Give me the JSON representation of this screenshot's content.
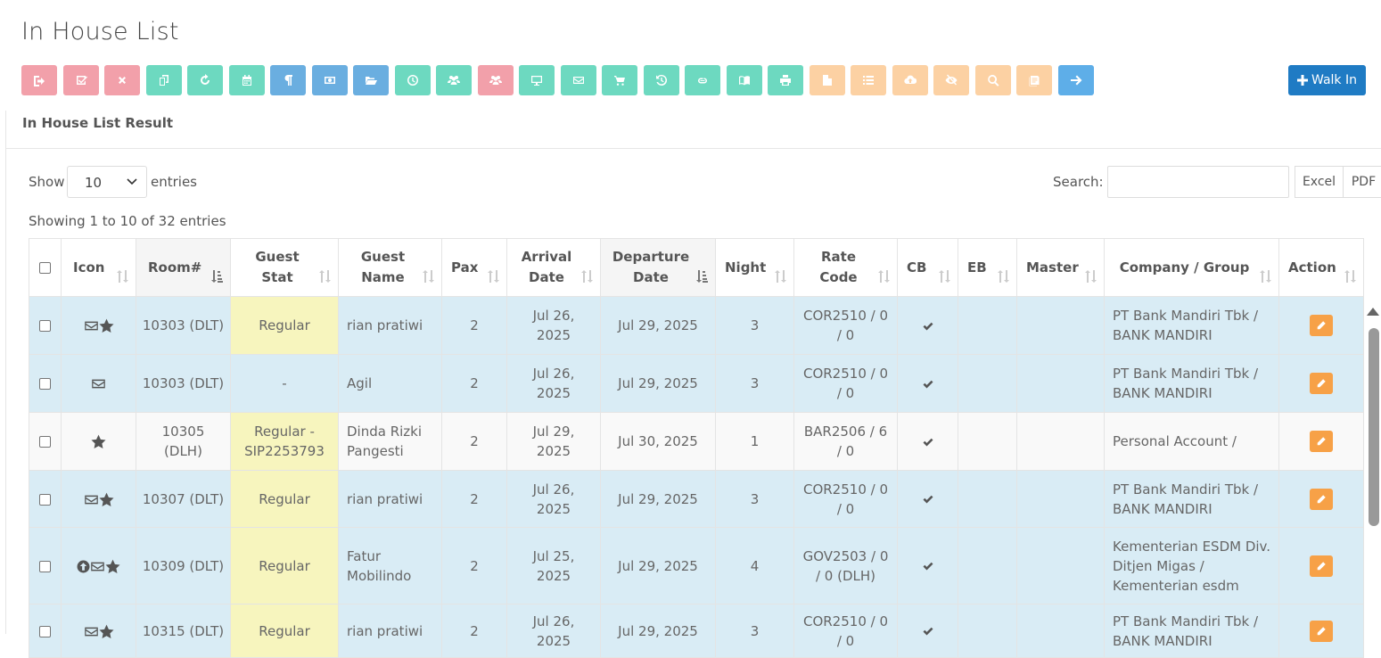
{
  "page": {
    "title": "In House List"
  },
  "toolbar": {
    "buttons": [
      {
        "icon": "sign-out-icon",
        "color": "#f2a0aa"
      },
      {
        "icon": "check-square-icon",
        "color": "#f2a0aa"
      },
      {
        "icon": "times-icon",
        "color": "#f2a0aa"
      },
      {
        "icon": "copy-icon",
        "color": "#6dd9c0"
      },
      {
        "icon": "refresh-icon",
        "color": "#6dd9c0"
      },
      {
        "icon": "calendar-icon",
        "color": "#6dd9c0"
      },
      {
        "icon": "paragraph-icon",
        "color": "#6aaee0"
      },
      {
        "icon": "money-icon",
        "color": "#6aaee0"
      },
      {
        "icon": "folder-open-icon",
        "color": "#6aaee0"
      },
      {
        "icon": "clock-icon",
        "color": "#6dd9c0"
      },
      {
        "icon": "users-icon",
        "color": "#6dd9c0"
      },
      {
        "icon": "users-icon",
        "color": "#f2a0aa"
      },
      {
        "icon": "desktop-icon",
        "color": "#6dd9c0"
      },
      {
        "icon": "envelope-icon",
        "color": "#6dd9c0"
      },
      {
        "icon": "cart-icon",
        "color": "#6dd9c0"
      },
      {
        "icon": "history-icon",
        "color": "#6dd9c0"
      },
      {
        "icon": "link-icon",
        "color": "#6dd9c0"
      },
      {
        "icon": "book-icon",
        "color": "#6dd9c0"
      },
      {
        "icon": "print-icon",
        "color": "#6dd9c0"
      },
      {
        "icon": "file-icon",
        "color": "#fcd1a3"
      },
      {
        "icon": "list-icon",
        "color": "#fcd1a3"
      },
      {
        "icon": "cloud-upload-icon",
        "color": "#fcd1a3"
      },
      {
        "icon": "eye-slash-icon",
        "color": "#fcd1a3"
      },
      {
        "icon": "search-icon",
        "color": "#fcd1a3"
      },
      {
        "icon": "notes-icon",
        "color": "#fcd1a3"
      },
      {
        "icon": "arrow-right-icon",
        "color": "#5eaee8"
      }
    ],
    "walk_in_label": "Walk In"
  },
  "panel": {
    "title": "In House List Result"
  },
  "controls": {
    "show_label": "Show",
    "entries_value": "10",
    "entries_label": "entries",
    "search_label": "Search:",
    "search_value": "",
    "excel_label": "Excel",
    "pdf_label": "PDF",
    "info": "Showing 1 to 10 of 32 entries"
  },
  "table": {
    "headers": {
      "icon": "Icon",
      "room": "Room#",
      "guest_stat": [
        "Guest",
        "Stat"
      ],
      "guest_name": [
        "Guest",
        "Name"
      ],
      "pax": "Pax",
      "arrival": [
        "Arrival",
        "Date"
      ],
      "departure": [
        "Departure",
        "Date"
      ],
      "night": "Night",
      "rate_code": [
        "Rate",
        "Code"
      ],
      "cb": "CB",
      "eb": "EB",
      "master": "Master",
      "company": "Company / Group",
      "action": "Action"
    },
    "rows": [
      {
        "icons": [
          "envelope-icon",
          "star-icon"
        ],
        "room": [
          "10303 (DLT)"
        ],
        "guest_stat": [
          "Regular"
        ],
        "stat_highlight": true,
        "guest_name": [
          "rian pratiwi"
        ],
        "pax": "2",
        "arrival": [
          "Jul 26,",
          "2025"
        ],
        "departure": "Jul 29, 2025",
        "night": "3",
        "rate_code": [
          "COR2510 / 0",
          "/ 0"
        ],
        "cb": true,
        "eb": "",
        "master": "",
        "company": [
          "PT Bank Mandiri Tbk /",
          "BANK MANDIRI"
        ],
        "shade": "blue"
      },
      {
        "icons": [
          "envelope-icon"
        ],
        "room": [
          "10303 (DLT)"
        ],
        "guest_stat": [
          "-"
        ],
        "stat_highlight": false,
        "guest_name": [
          "Agil"
        ],
        "pax": "2",
        "arrival": [
          "Jul 26,",
          "2025"
        ],
        "departure": "Jul 29, 2025",
        "night": "3",
        "rate_code": [
          "COR2510 / 0",
          "/ 0"
        ],
        "cb": true,
        "eb": "",
        "master": "",
        "company": [
          "PT Bank Mandiri Tbk /",
          "BANK MANDIRI"
        ],
        "shade": "blue"
      },
      {
        "icons": [
          "star-icon"
        ],
        "room": [
          "10305",
          "(DLH)"
        ],
        "guest_stat": [
          "Regular -",
          "SIP2253793"
        ],
        "stat_highlight": true,
        "guest_name": [
          "Dinda Rizki",
          "Pangesti"
        ],
        "pax": "2",
        "arrival": [
          "Jul 29,",
          "2025"
        ],
        "departure": "Jul 30, 2025",
        "night": "1",
        "rate_code": [
          "BAR2506 / 6",
          "/ 0"
        ],
        "cb": true,
        "eb": "",
        "master": "",
        "company": [
          "Personal Account /"
        ],
        "shade": "white"
      },
      {
        "icons": [
          "envelope-icon",
          "star-icon"
        ],
        "room": [
          "10307 (DLT)"
        ],
        "guest_stat": [
          "Regular"
        ],
        "stat_highlight": true,
        "guest_name": [
          "rian pratiwi"
        ],
        "pax": "2",
        "arrival": [
          "Jul 26,",
          "2025"
        ],
        "departure": "Jul 29, 2025",
        "night": "3",
        "rate_code": [
          "COR2510 / 0",
          "/ 0"
        ],
        "cb": true,
        "eb": "",
        "master": "",
        "company": [
          "PT Bank Mandiri Tbk /",
          "BANK MANDIRI"
        ],
        "shade": "blue"
      },
      {
        "icons": [
          "arrow-up-circle-icon",
          "envelope-icon",
          "star-icon"
        ],
        "room": [
          "10309 (DLT)"
        ],
        "guest_stat": [
          "Regular"
        ],
        "stat_highlight": true,
        "guest_name": [
          "Fatur",
          "Mobilindo"
        ],
        "pax": "2",
        "arrival": [
          "Jul 25,",
          "2025"
        ],
        "departure": "Jul 29, 2025",
        "night": "4",
        "rate_code": [
          "GOV2503 / 0",
          "/ 0 (DLH)"
        ],
        "cb": true,
        "eb": "",
        "master": "",
        "company": [
          "Kementerian ESDM Div.",
          "Ditjen Migas /",
          "Kementerian esdm"
        ],
        "shade": "blue"
      },
      {
        "icons": [
          "envelope-icon",
          "star-icon"
        ],
        "room": [
          "10315 (DLT)"
        ],
        "guest_stat": [
          "Regular"
        ],
        "stat_highlight": true,
        "guest_name": [
          "rian pratiwi"
        ],
        "pax": "2",
        "arrival": [
          "Jul 26,",
          "2025"
        ],
        "departure": "Jul 29, 2025",
        "night": "3",
        "rate_code": [
          "COR2510 / 0",
          "/ 0"
        ],
        "cb": true,
        "eb": "",
        "master": "",
        "company": [
          "PT Bank Mandiri Tbk /",
          "BANK MANDIRI"
        ],
        "shade": "blue"
      }
    ]
  }
}
